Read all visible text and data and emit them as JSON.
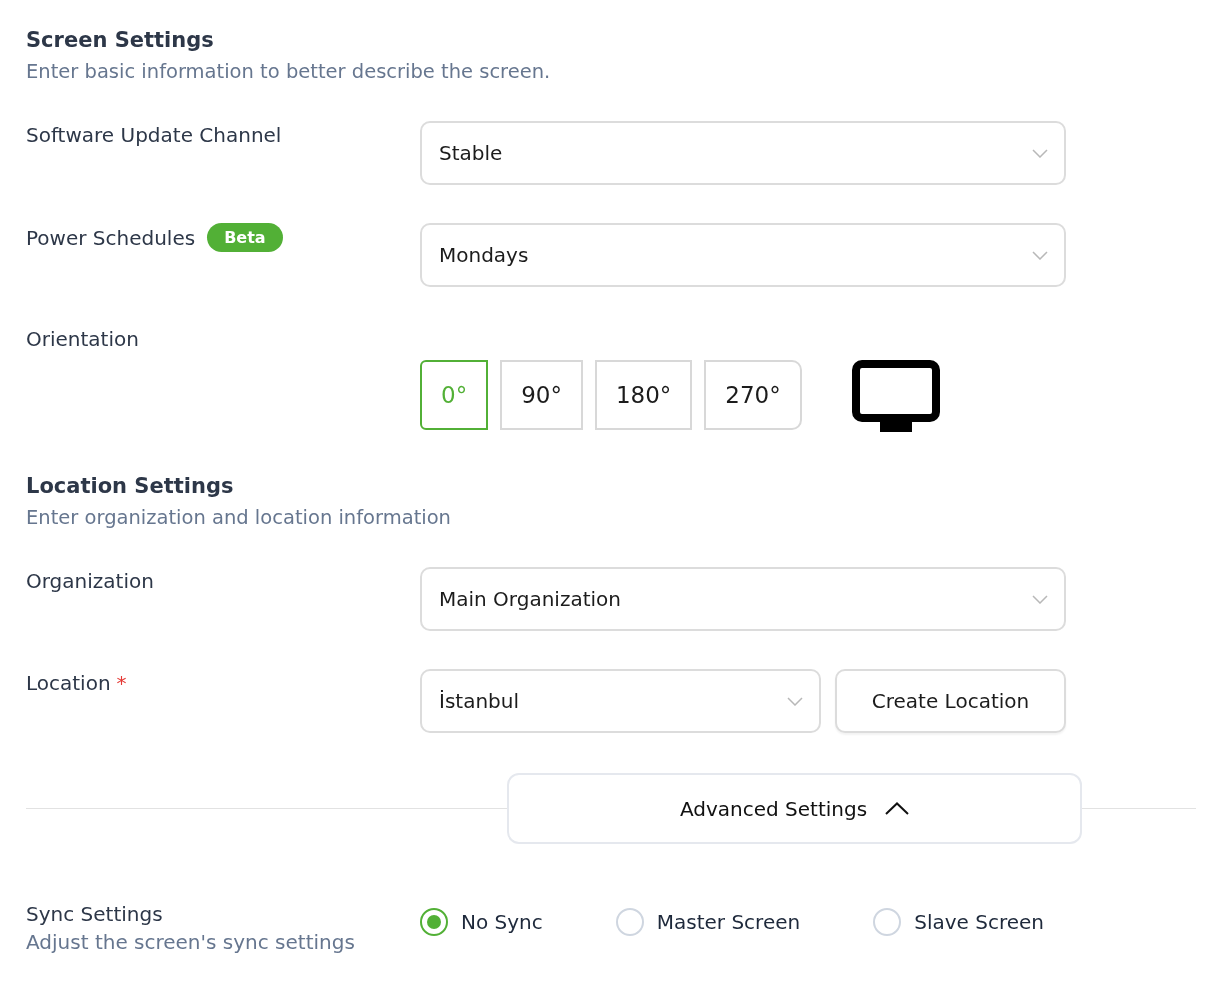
{
  "sections": [
    {
      "title": "Screen Settings",
      "subtitle": "Enter basic information to better describe the screen.",
      "fields": [
        {
          "kind": "select",
          "label": "Software Update Channel",
          "value": "Stable"
        },
        {
          "kind": "select",
          "label": "Power Schedules",
          "badge": "Beta",
          "value": "Mondays"
        },
        {
          "kind": "orientation",
          "label": "Orientation",
          "options": [
            {
              "label": "0°",
              "selected": true
            },
            {
              "label": "90°",
              "selected": false
            },
            {
              "label": "180°",
              "selected": false
            },
            {
              "label": "270°",
              "selected": false
            }
          ]
        }
      ]
    },
    {
      "title": "Location Settings",
      "subtitle": "Enter organization and location information",
      "fields": [
        {
          "kind": "select",
          "label": "Organization",
          "value": "Main Organization"
        },
        {
          "kind": "select",
          "label": "Location",
          "required_mark": "*",
          "value": "İstanbul",
          "button": "Create Location"
        }
      ]
    }
  ],
  "advanced_settings": {
    "label": "Advanced Settings",
    "expanded": true
  },
  "sync_settings": {
    "label": "Sync Settings",
    "subtitle": "Adjust the screen's sync settings",
    "options": [
      {
        "label": "No Sync",
        "selected": true
      },
      {
        "label": "Master Screen",
        "selected": false
      },
      {
        "label": "Slave Screen",
        "selected": false
      }
    ]
  }
}
